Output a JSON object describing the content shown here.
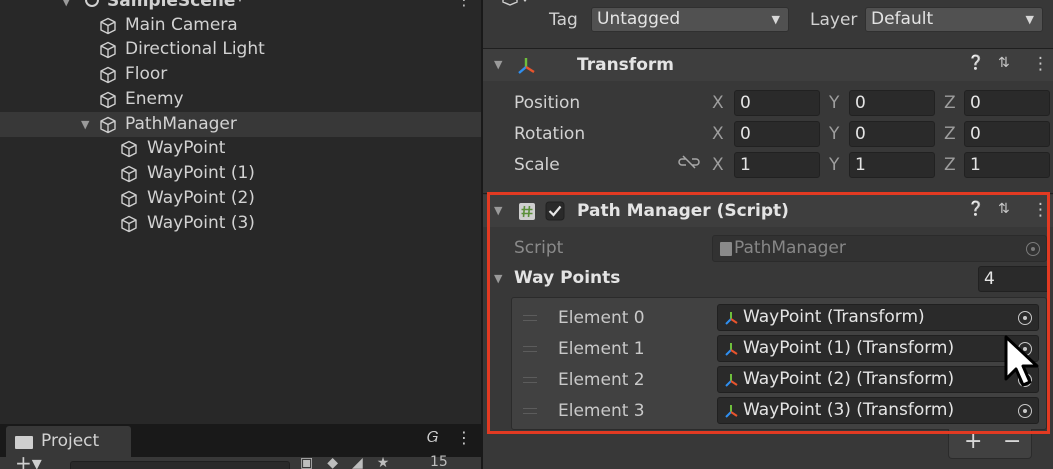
{
  "hierarchy": {
    "scene_name": "SampleScene*",
    "items": [
      {
        "label": "Main Camera"
      },
      {
        "label": "Directional Light"
      },
      {
        "label": "Floor"
      },
      {
        "label": "Enemy"
      },
      {
        "label": "PathManager"
      },
      {
        "label": "WayPoint"
      },
      {
        "label": "WayPoint (1)"
      },
      {
        "label": "WayPoint (2)"
      },
      {
        "label": "WayPoint (3)"
      }
    ]
  },
  "project": {
    "tab_label": "Project",
    "item_count": "15"
  },
  "inspector": {
    "tag_label": "Tag",
    "tag_value": "Untagged",
    "layer_label": "Layer",
    "layer_value": "Default",
    "transform": {
      "title": "Transform",
      "rows": [
        {
          "label": "Position",
          "x": "0",
          "y": "0",
          "z": "0"
        },
        {
          "label": "Rotation",
          "x": "0",
          "y": "0",
          "z": "0"
        },
        {
          "label": "Scale",
          "x": "1",
          "y": "1",
          "z": "1"
        }
      ],
      "axes": {
        "x": "X",
        "y": "Y",
        "z": "Z"
      }
    },
    "path_manager": {
      "title": "Path Manager (Script)",
      "enabled": true,
      "script_label": "Script",
      "script_value": "PathManager",
      "way_points_label": "Way Points",
      "way_points_size": "4",
      "elements": [
        {
          "label": "Element 0",
          "value": "WayPoint (Transform)"
        },
        {
          "label": "Element 1",
          "value": "WayPoint (1) (Transform)"
        },
        {
          "label": "Element 2",
          "value": "WayPoint (2) (Transform)"
        },
        {
          "label": "Element 3",
          "value": "WayPoint (3) (Transform)"
        }
      ],
      "add_label": "+",
      "remove_label": "−"
    }
  },
  "colors": {
    "highlight": "#e23a22",
    "panel_bg": "#383838",
    "hierarchy_bg": "#282828",
    "field_bg": "#2a2a2a"
  },
  "icons": {
    "game_object": "cube-icon",
    "transform": "transform-axes-icon",
    "script": "script-hash-icon",
    "help": "help-icon",
    "preset": "preset-icon",
    "menu": "kebab-menu-icon",
    "object_picker": "target-icon",
    "constrain": "link-icon"
  }
}
